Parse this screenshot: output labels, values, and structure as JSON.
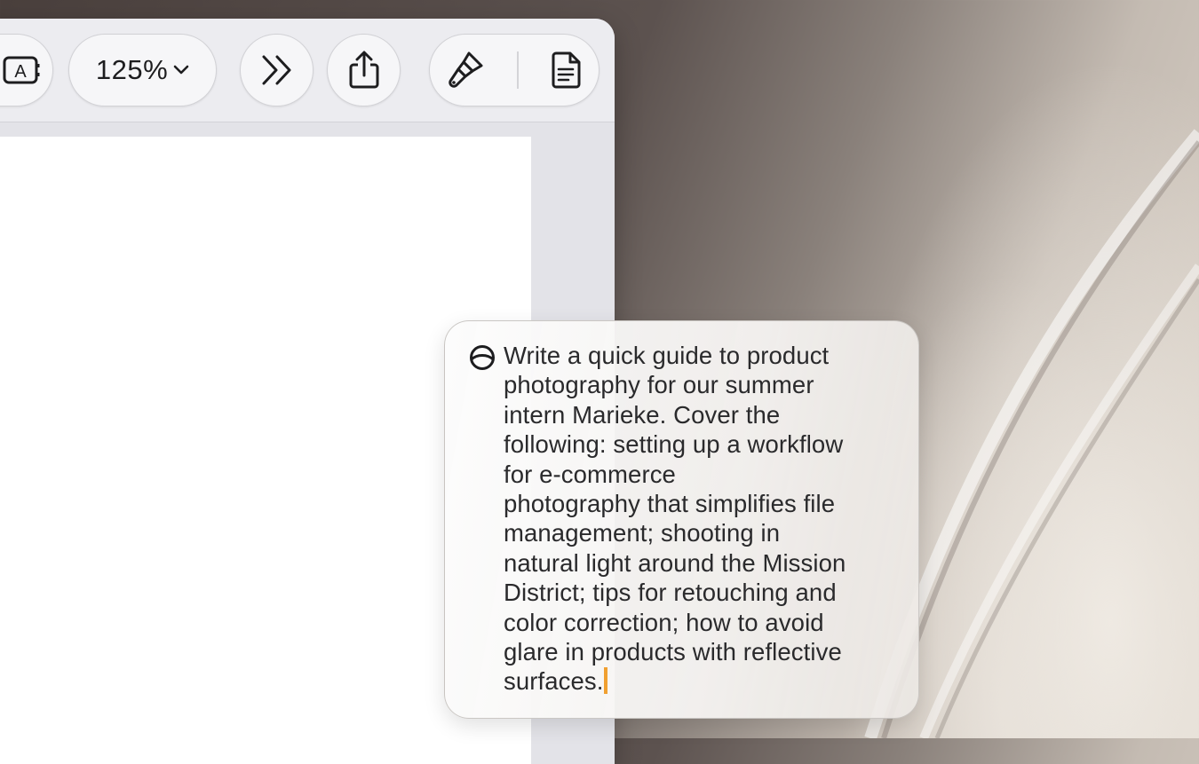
{
  "toolbar": {
    "text_box_label": "A",
    "zoom_value": "125%",
    "buttons": [
      "text-box",
      "zoom",
      "more",
      "share",
      "format",
      "document"
    ]
  },
  "prompt": {
    "text": "Write a quick guide to product\nphotography for our summer\nintern Marieke. Cover the\nfollowing: setting up a workflow\nfor e-commerce\nphotography that simplifies file\nmanagement; shooting in\nnatural light around the Mission\nDistrict; tips for retouching and\ncolor correction; how to avoid\nglare in products with reflective\nsurfaces.",
    "caret_color": "#f0a030"
  },
  "colors": {
    "toolbar_bg": "#ececf0",
    "page_bg": "#ffffff",
    "window_bg": "#e3e3e8"
  }
}
